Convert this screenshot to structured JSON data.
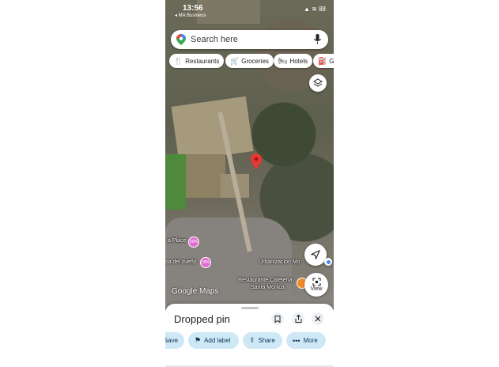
{
  "status_bar": {
    "time": "13:56",
    "carrier": "◂ MA Business",
    "system_icons": "▲ ≋ 88"
  },
  "search": {
    "placeholder": "Search here"
  },
  "chips": [
    {
      "icon": "🍴",
      "label": "Restaurants"
    },
    {
      "icon": "🛒",
      "label": "Groceries"
    },
    {
      "icon": "🛏",
      "label": "Hotels"
    },
    {
      "icon": "⛽",
      "label": "Ga"
    }
  ],
  "map_labels": {
    "place1": "a Place",
    "place2": "sa del sueño",
    "place3": "Urbanizacion Mo",
    "place4": "Restaurante Cafeteria",
    "place5": "Santa Monica",
    "poi_badge": "20%"
  },
  "google_maps_label": "Google Maps",
  "view_button": {
    "label": "View"
  },
  "sheet": {
    "title": "Dropped pin",
    "actions": [
      {
        "icon": "",
        "label": "Save"
      },
      {
        "icon": "⚑",
        "label": "Add label"
      },
      {
        "icon": "⇪",
        "label": "Share"
      },
      {
        "icon": "•••",
        "label": "More"
      }
    ]
  },
  "colors": {
    "pin": "#e53935",
    "chip_action_bg": "#cfe8f6",
    "poi": "#e26bd1"
  }
}
